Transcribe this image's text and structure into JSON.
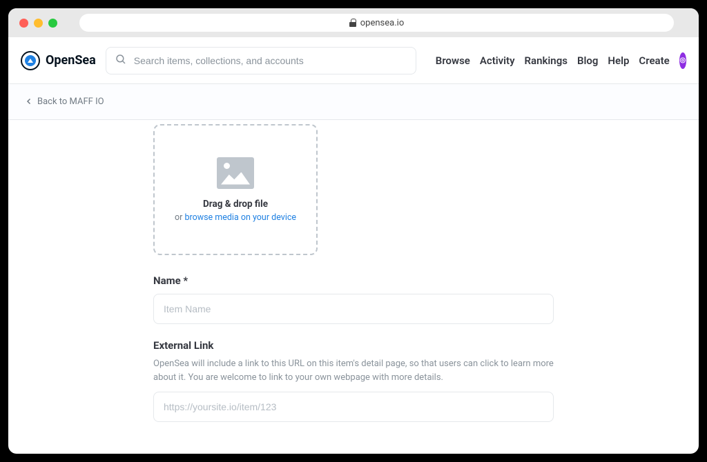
{
  "browser": {
    "url_host": "opensea.io"
  },
  "logo": {
    "text": "OpenSea"
  },
  "search": {
    "placeholder": "Search items, collections, and accounts"
  },
  "nav": {
    "browse": "Browse",
    "activity": "Activity",
    "rankings": "Rankings",
    "blog": "Blog",
    "help": "Help",
    "create": "Create"
  },
  "subnav": {
    "back_label": "Back to MAFF IO"
  },
  "dropzone": {
    "main": "Drag & drop file",
    "sub_prefix": "or ",
    "browse_link": "browse media on your device"
  },
  "form": {
    "name": {
      "label": "Name *",
      "placeholder": "Item Name"
    },
    "external": {
      "label": "External Link",
      "description": "OpenSea will include a link to this URL on this item's detail page, so that users can click to learn more about it. You are welcome to link to your own webpage with more details.",
      "placeholder": "https://yoursite.io/item/123"
    }
  }
}
